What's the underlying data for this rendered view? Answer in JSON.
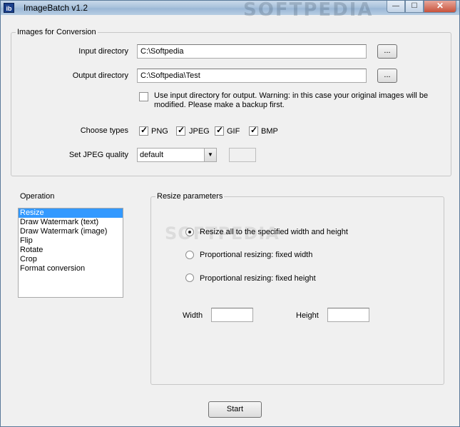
{
  "window": {
    "title": "ImageBatch v1.2",
    "icon_text": "ib",
    "watermark": "SOFTPEDIA",
    "controls": {
      "minimize": "—",
      "maximize": "☐",
      "close": "✕"
    }
  },
  "conversion": {
    "legend": "Images for Conversion",
    "input_label": "Input directory",
    "input_value": "C:\\Softpedia",
    "output_label": "Output directory",
    "output_value": "C:\\Softpedia\\Test",
    "browse_label": "...",
    "use_input_text_1": "Use input directory for output. Warning: in this case your original images will be",
    "use_input_text_2": "modified. Please make a backup first.",
    "use_input_checked": false,
    "types_label": "Choose types",
    "types": [
      {
        "label": "PNG",
        "checked": true
      },
      {
        "label": "JPEG",
        "checked": true
      },
      {
        "label": "GIF",
        "checked": true
      },
      {
        "label": "BMP",
        "checked": true
      }
    ],
    "jpeg_label": "Set JPEG quality",
    "jpeg_value": "default"
  },
  "operation": {
    "label": "Operation",
    "items": [
      "Resize",
      "Draw Watermark (text)",
      "Draw Watermark (image)",
      "Flip",
      "Rotate",
      "Crop",
      "Format conversion"
    ],
    "selected": "Resize"
  },
  "resize": {
    "legend": "Resize parameters",
    "options": [
      {
        "label": "Resize all to the specified width and height",
        "selected": true
      },
      {
        "label": "Proportional resizing: fixed width",
        "selected": false
      },
      {
        "label": "Proportional resizing: fixed height",
        "selected": false
      }
    ],
    "width_label": "Width",
    "width_value": "",
    "height_label": "Height",
    "height_value": "",
    "watermark": "SOFTPEDIA"
  },
  "start_label": "Start"
}
